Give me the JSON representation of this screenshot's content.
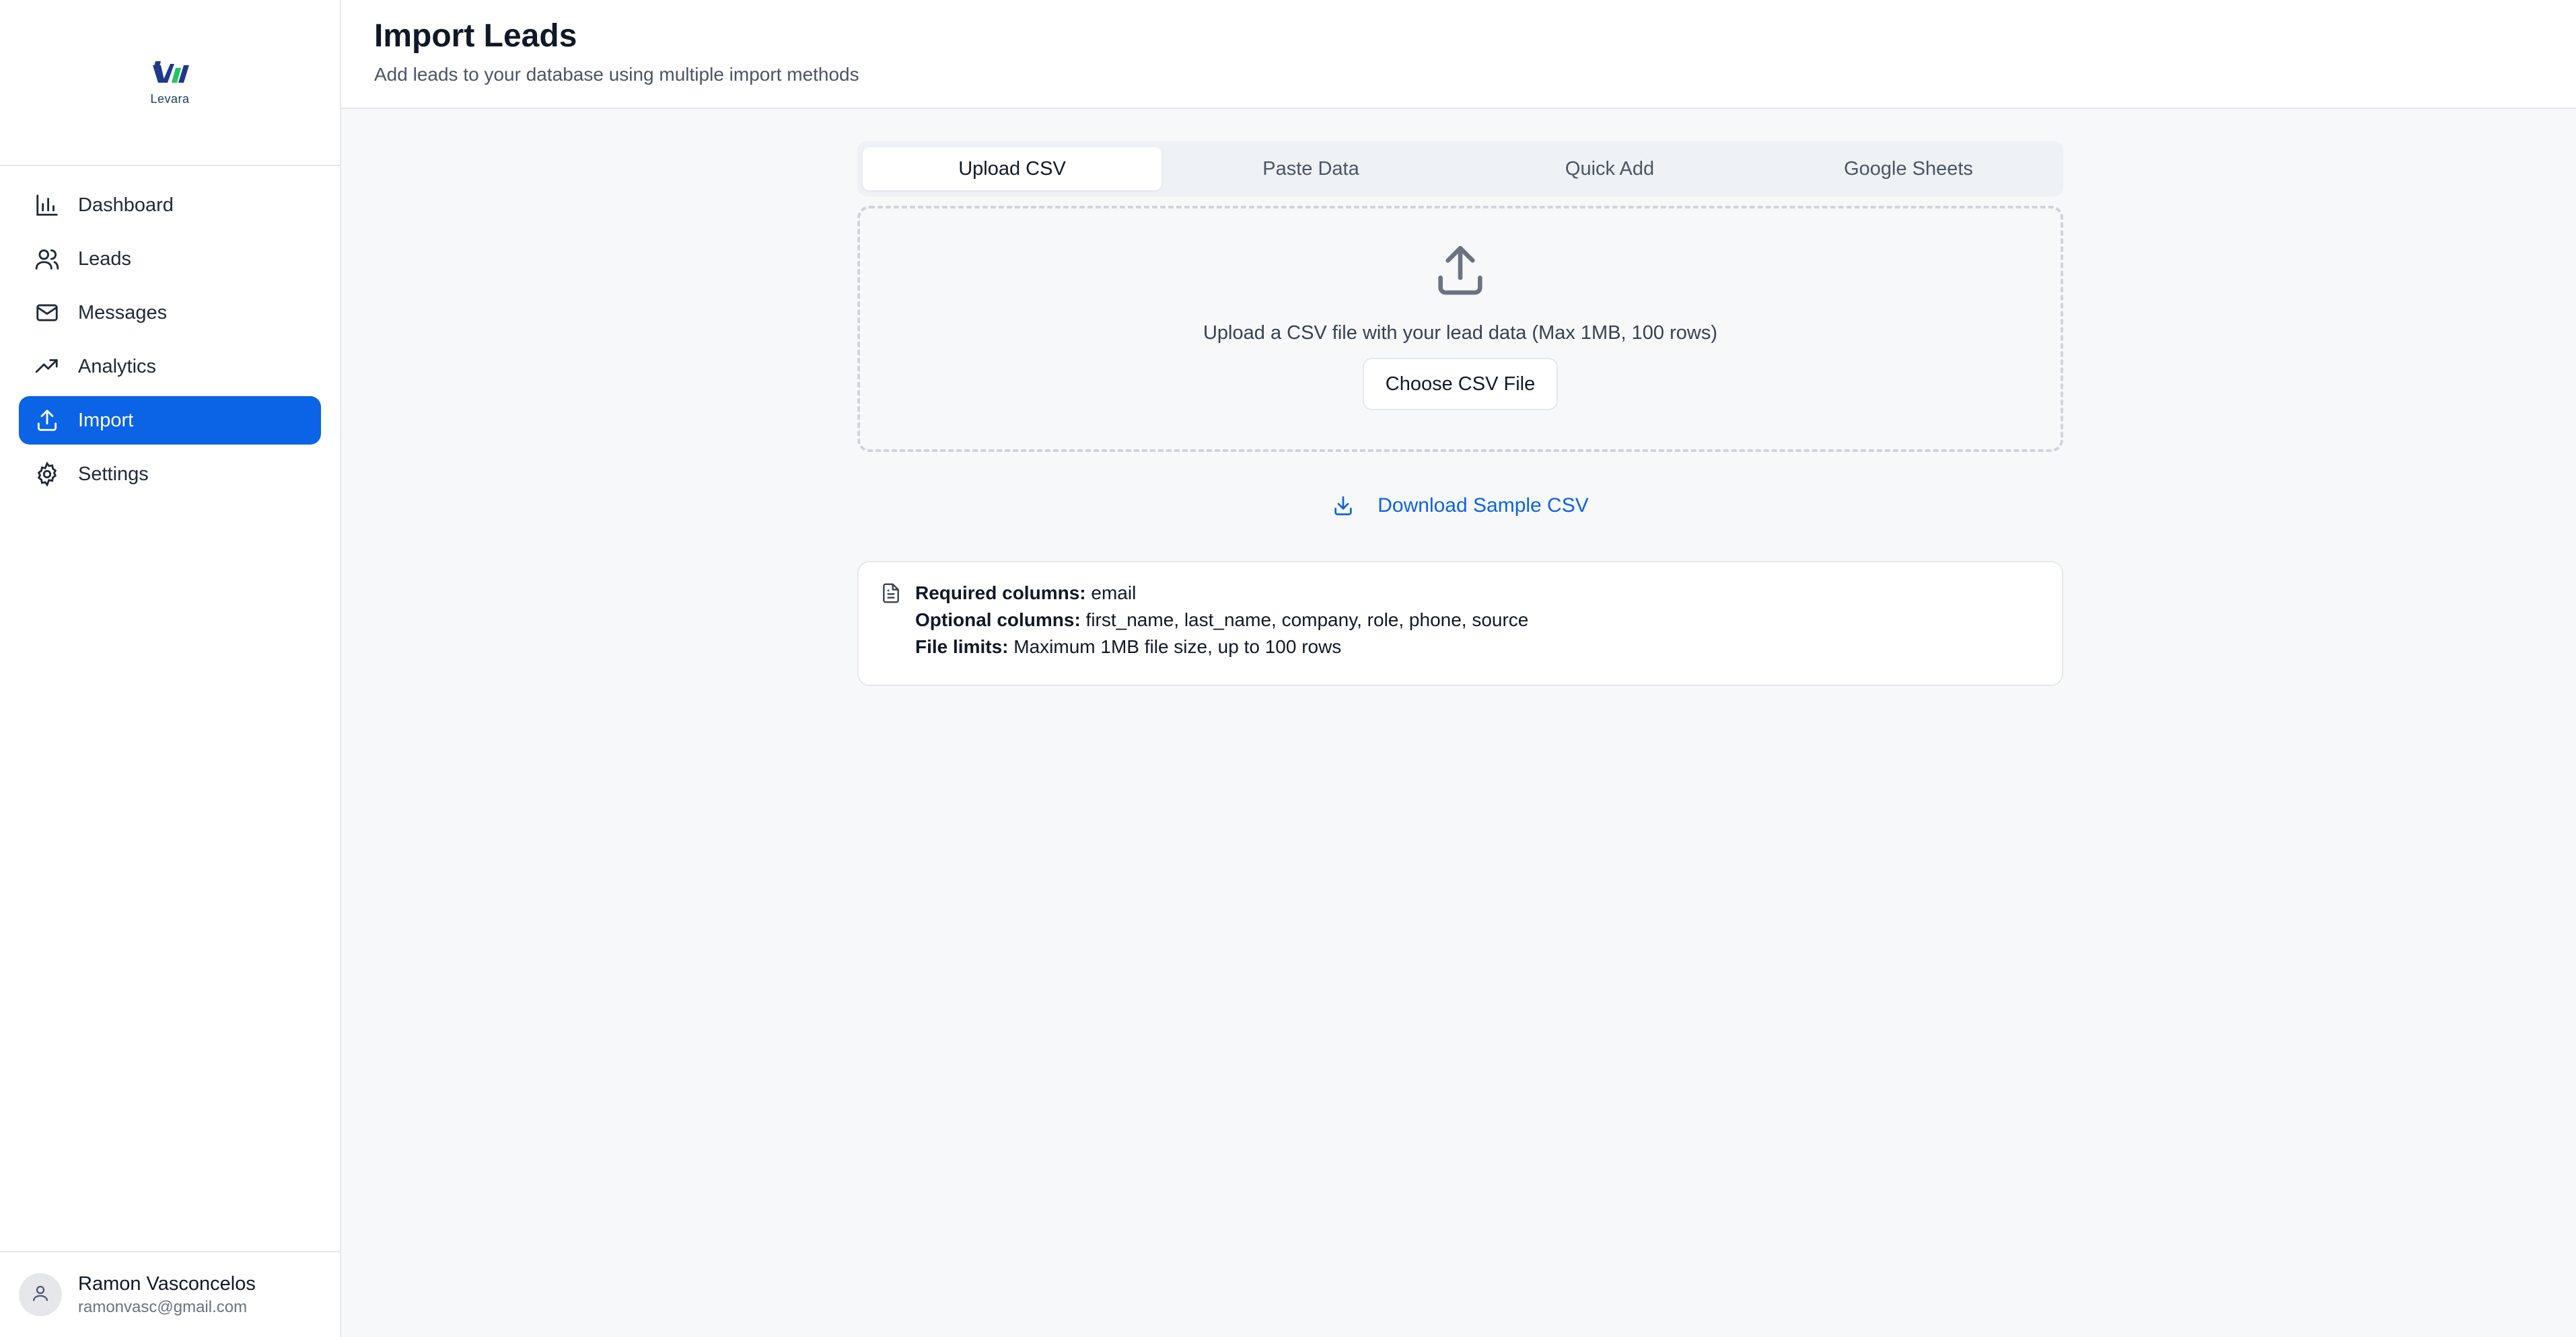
{
  "brand": {
    "name": "Levara",
    "colors": {
      "primary": "#0b63e6",
      "logo_green": "#22c55e",
      "logo_navy": "#1e3a8a"
    }
  },
  "sidebar": {
    "items": [
      {
        "label": "Dashboard",
        "icon": "bar-chart-icon",
        "active": false
      },
      {
        "label": "Leads",
        "icon": "users-icon",
        "active": false
      },
      {
        "label": "Messages",
        "icon": "mail-icon",
        "active": false
      },
      {
        "label": "Analytics",
        "icon": "trending-up-icon",
        "active": false
      },
      {
        "label": "Import",
        "icon": "upload-icon",
        "active": true
      },
      {
        "label": "Settings",
        "icon": "gear-icon",
        "active": false
      }
    ],
    "user": {
      "name": "Ramon Vasconcelos",
      "email": "ramonvasc@gmail.com",
      "icon": "user-icon"
    }
  },
  "header": {
    "title": "Import Leads",
    "subtitle": "Add leads to your database using multiple import methods"
  },
  "tabs": [
    {
      "label": "Upload CSV",
      "active": true
    },
    {
      "label": "Paste Data",
      "active": false
    },
    {
      "label": "Quick Add",
      "active": false
    },
    {
      "label": "Google Sheets",
      "active": false
    }
  ],
  "upload": {
    "icon": "upload-icon",
    "text": "Upload a CSV file with your lead data (Max 1MB, 100 rows)",
    "button_label": "Choose CSV File"
  },
  "download": {
    "label": "Download Sample CSV",
    "icon": "download-icon"
  },
  "info": {
    "icon": "document-icon",
    "required_label": "Required columns:",
    "required_value": " email",
    "optional_label": "Optional columns:",
    "optional_value": " first_name, last_name, company, role, phone, source",
    "limits_label": "File limits:",
    "limits_value": " Maximum 1MB file size, up to 100 rows"
  }
}
